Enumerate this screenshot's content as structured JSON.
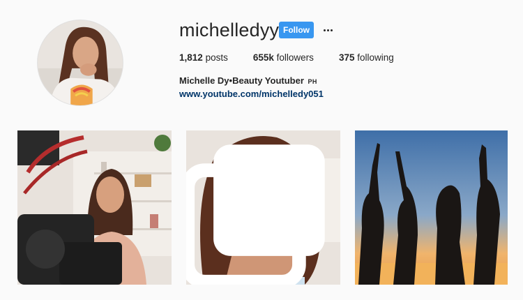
{
  "profile": {
    "username": "michelledyy",
    "follow_label": "Follow",
    "more_icon": "ellipsis-icon",
    "stats": {
      "posts_count": "1,812",
      "posts_label": "posts",
      "followers_count": "655k",
      "followers_label": "followers",
      "following_count": "375",
      "following_label": "following"
    },
    "full_name": "Michelle Dy•Beauty Youtuber",
    "full_name_suffix": "PH",
    "website": "www.youtube.com/michelledy051"
  },
  "posts": [
    {
      "kind": "photo"
    },
    {
      "kind": "carousel",
      "badge_icon": "multiple-photos-icon"
    },
    {
      "kind": "photo"
    }
  ],
  "colors": {
    "follow_button": "#3897f0",
    "link": "#003569",
    "background": "#fafafa"
  }
}
